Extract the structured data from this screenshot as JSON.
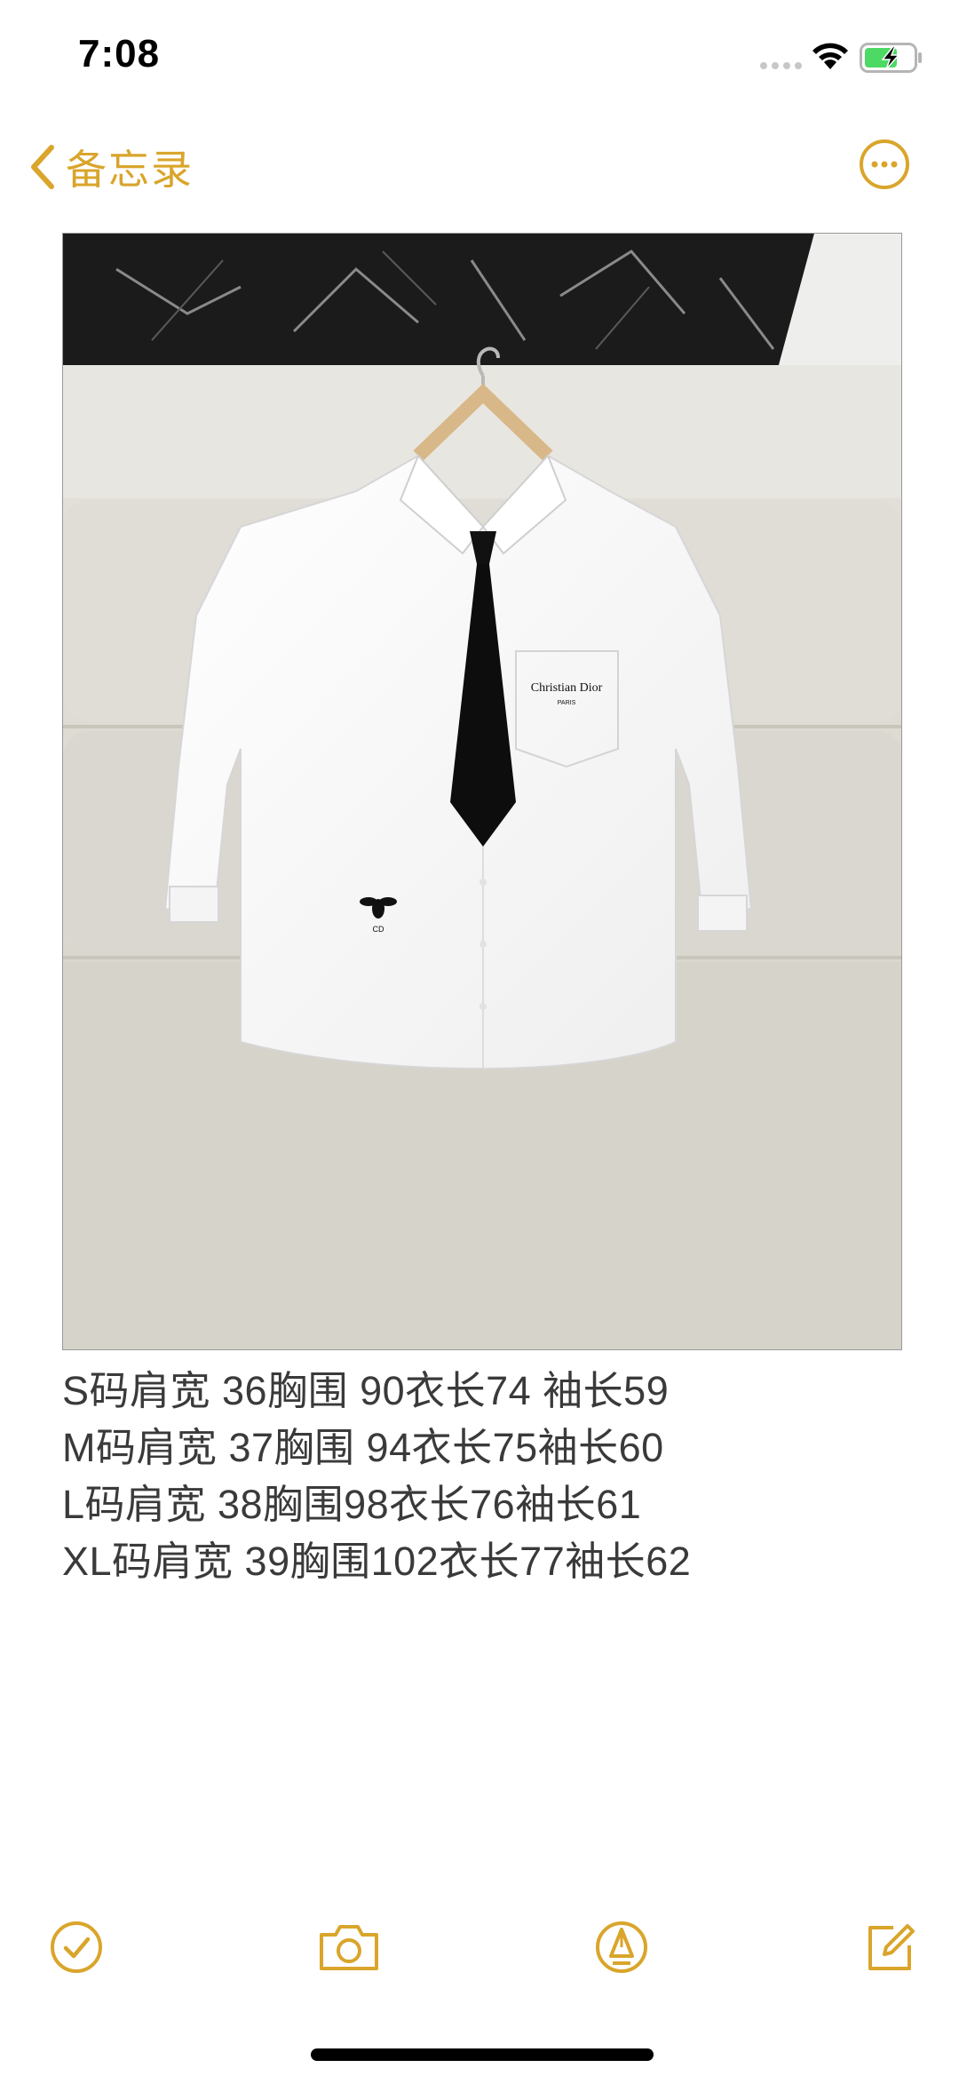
{
  "status_bar": {
    "time": "7:08"
  },
  "nav": {
    "back_label": "备忘录",
    "back_icon": "chevron-left-icon",
    "more_icon": "ellipsis-circle-icon"
  },
  "colors": {
    "accent": "#d9a52b",
    "text": "#3a3a3a",
    "battery_fill": "#4cd964"
  },
  "photo": {
    "logo_text": "Christian Dior",
    "logo_subtext": "PARIS",
    "emblem_text": "CD"
  },
  "note": {
    "lines": [
      "S码肩宽 36胸围 90衣长74 袖长59",
      "M码肩宽 37胸围 94衣长75袖长60",
      "L码肩宽 38胸围98衣长76袖长61",
      "XL码肩宽 39胸围102衣长77袖长62"
    ]
  },
  "toolbar": {
    "items": [
      {
        "name": "checklist",
        "icon": "checkmark-circle-icon"
      },
      {
        "name": "camera",
        "icon": "camera-icon"
      },
      {
        "name": "markup",
        "icon": "pen-tip-circle-icon"
      },
      {
        "name": "compose",
        "icon": "compose-icon"
      }
    ]
  }
}
